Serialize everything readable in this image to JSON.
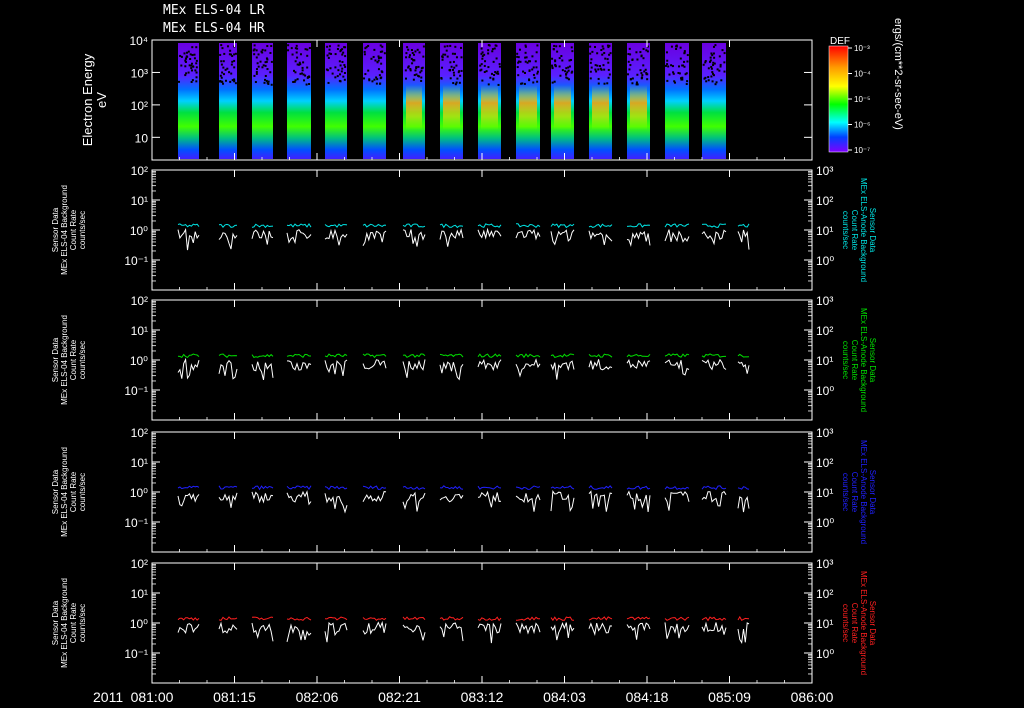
{
  "header": {
    "title_lines": [
      "MEx ELS-04 LR",
      "MEx ELS-04 HR"
    ]
  },
  "colorbar": {
    "label": "DEF",
    "unit_label": "ergs/(cm**2-sr-sec-eV)",
    "tick_labels": [
      "10⁻³",
      "10⁻⁴",
      "10⁻⁵",
      "10⁻⁶",
      "10⁻⁷"
    ]
  },
  "x_axis": {
    "year": "2011",
    "tick_labels": [
      "081:00",
      "081:15",
      "082:06",
      "082:21",
      "083:12",
      "084:03",
      "084:18",
      "085:09",
      "086:00"
    ]
  },
  "chart_data": [
    {
      "type": "heatmap",
      "ylabel": "Electron Energy\neV",
      "y_scale": "log",
      "ylim": [
        2,
        10000
      ],
      "y_tick_labels": [
        "10",
        "10²",
        "10³",
        "10⁴"
      ],
      "observation_blocks": 15,
      "peak_energy_eV": 100,
      "colorbar_range": [
        1e-07,
        0.001
      ]
    },
    {
      "type": "line",
      "ylabel": "Sensor Data\nMEx ELS-04 Background\nCount Rate\ncounts/sec",
      "right_label": "Sensor Data\nMEx ELS-Anode Background\nCount Rate\ncounts/sec",
      "y_scale": "log",
      "ylim": [
        0.01,
        100
      ],
      "right_ylim": [
        0.1,
        1000
      ],
      "y_tick_labels": [
        "10⁻¹",
        "10⁰",
        "10¹",
        "10²"
      ],
      "right_tick_labels": [
        "10⁰",
        "10¹",
        "10²",
        "10³"
      ],
      "series": [
        {
          "color": "#00e5e5",
          "level": 1.4
        },
        {
          "color": "#ffffff",
          "level": 0.7
        }
      ]
    },
    {
      "type": "line",
      "ylabel": "Sensor Data\nMEx ELS-04 Background\nCount Rate\ncounts/sec",
      "right_label": "Sensor Data\nMEx ELS-Anode Background\nCount Rate\ncounts/sec",
      "y_scale": "log",
      "ylim": [
        0.01,
        100
      ],
      "right_ylim": [
        0.1,
        1000
      ],
      "y_tick_labels": [
        "10⁻¹",
        "10⁰",
        "10¹",
        "10²"
      ],
      "right_tick_labels": [
        "10⁰",
        "10¹",
        "10²",
        "10³"
      ],
      "series": [
        {
          "color": "#00e000",
          "level": 1.4
        },
        {
          "color": "#ffffff",
          "level": 0.7
        }
      ]
    },
    {
      "type": "line",
      "ylabel": "Sensor Data\nMEx ELS-04 Background\nCount Rate\ncounts/sec",
      "right_label": "Sensor Data\nMEx ELS-Anode Background\nCount Rate\ncounts/sec",
      "y_scale": "log",
      "ylim": [
        0.01,
        100
      ],
      "right_ylim": [
        0.1,
        1000
      ],
      "y_tick_labels": [
        "10⁻¹",
        "10⁰",
        "10¹",
        "10²"
      ],
      "right_tick_labels": [
        "10⁰",
        "10¹",
        "10²",
        "10³"
      ],
      "series": [
        {
          "color": "#2020ff",
          "level": 1.4
        },
        {
          "color": "#ffffff",
          "level": 0.7
        }
      ]
    },
    {
      "type": "line",
      "ylabel": "Sensor Data\nMEx ELS-04 Background\nCount Rate\ncounts/sec",
      "right_label": "Sensor Data\nMEx ELS-Anode Background\nCount Rate\ncounts/sec",
      "y_scale": "log",
      "ylim": [
        0.01,
        100
      ],
      "right_ylim": [
        0.1,
        1000
      ],
      "y_tick_labels": [
        "10⁻¹",
        "10⁰",
        "10¹",
        "10²"
      ],
      "right_tick_labels": [
        "10⁰",
        "10¹",
        "10²",
        "10³"
      ],
      "series": [
        {
          "color": "#ff2020",
          "level": 1.4
        },
        {
          "color": "#ffffff",
          "level": 0.7
        }
      ]
    }
  ]
}
